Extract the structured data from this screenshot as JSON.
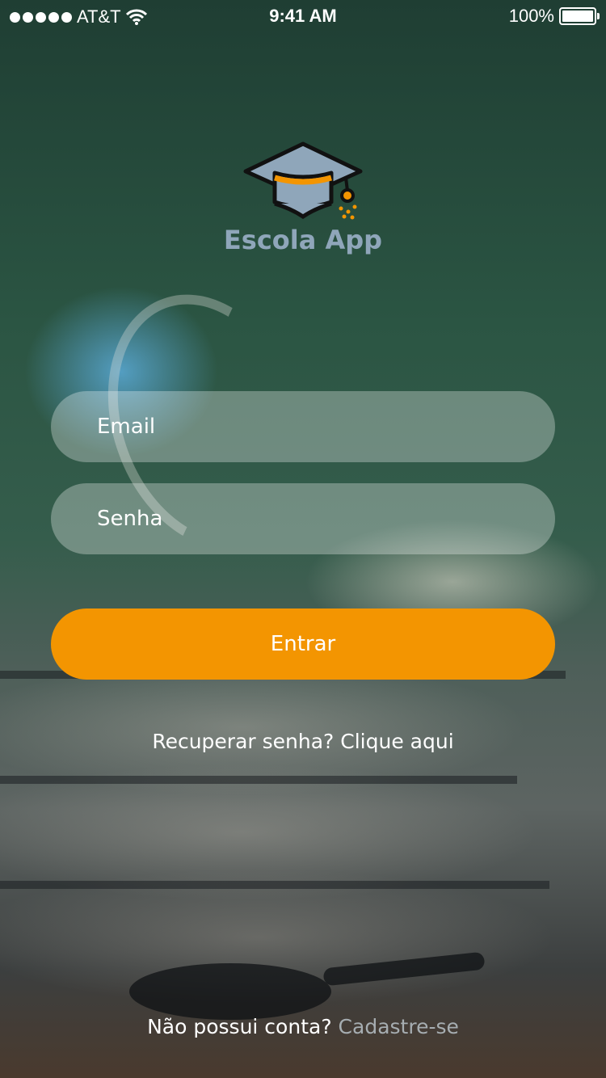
{
  "status_bar": {
    "carrier": "AT&T",
    "time": "9:41 AM",
    "battery": "100%",
    "signal_icon": "signal-dots-icon",
    "wifi_icon": "wifi-icon",
    "battery_icon": "battery-icon"
  },
  "app": {
    "name": "Escola App",
    "logo_icon": "graduation-cap-icon"
  },
  "form": {
    "email_placeholder": "Email",
    "password_placeholder": "Senha",
    "submit_label": "Entrar"
  },
  "links": {
    "recover": "Recuperar senha? Clique aqui",
    "signup_prompt": "Não possui conta?",
    "signup_link": "Cadastre-se"
  },
  "colors": {
    "accent": "#f39501",
    "app_name": "#8fa6ba",
    "link_muted": "#a6adb1"
  }
}
